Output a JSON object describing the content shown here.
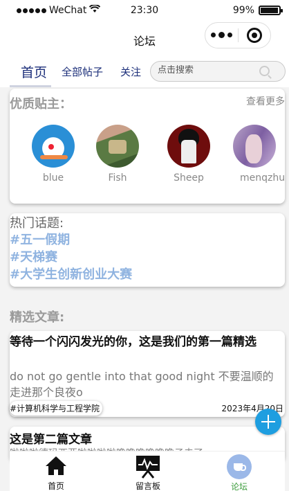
{
  "status_bar": {
    "carrier": "WeChat",
    "time": "23:30",
    "battery": "99%"
  },
  "nav": {
    "title": "论坛"
  },
  "tabs": [
    "首页",
    "全部帖子",
    "关注"
  ],
  "search": {
    "placeholder": "点击搜索"
  },
  "quality_users": {
    "heading": "优质贴主：",
    "more": "查看更多",
    "users": [
      {
        "name": "blue"
      },
      {
        "name": "Fish"
      },
      {
        "name": "Sheep"
      },
      {
        "name": "menqzhu"
      }
    ]
  },
  "hot_topics": {
    "heading": "热门话题:",
    "items": [
      "#五一假期",
      "#天梯赛",
      "#大学生创新创业大赛"
    ]
  },
  "articles": {
    "heading": "精选文章:",
    "items": [
      {
        "title": "等待一个闪闪发光的你，这是我们的第一篇精选",
        "body": "do not go gentle into that good night 不要温顺的走进那个良夜o",
        "tag": "#计算机科学与工程学院",
        "date": "2023年4月20日"
      },
      {
        "title": "这是第二篇文章",
        "body": "啦啦啦德玛西亚啦啦啦啦噜噜噜噜噜噜子去了"
      }
    ]
  },
  "tabbar": [
    "首页",
    "留言板",
    "论坛"
  ],
  "colors": {
    "accent": "#1e9ee0",
    "active_tab": "#3a9b3a",
    "topic": "#8fb3e0"
  }
}
